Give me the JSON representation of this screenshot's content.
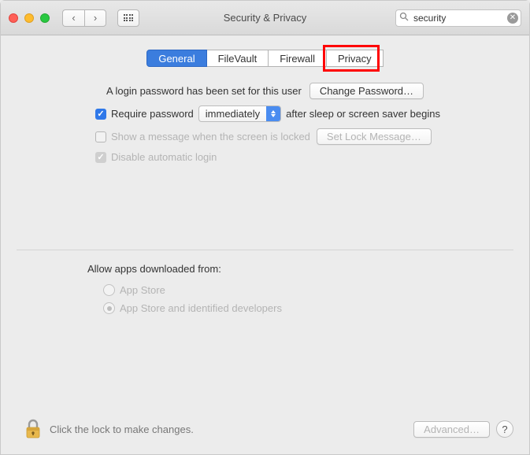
{
  "window": {
    "title": "Security & Privacy"
  },
  "search": {
    "value": "security"
  },
  "tabs": [
    {
      "label": "General",
      "active": true
    },
    {
      "label": "FileVault",
      "active": false
    },
    {
      "label": "Firewall",
      "active": false
    },
    {
      "label": "Privacy",
      "active": false
    }
  ],
  "main": {
    "login_password_text": "A login password has been set for this user",
    "change_password_btn": "Change Password…",
    "require_password_label": "Require password",
    "require_password_select": "immediately",
    "require_password_suffix": "after sleep or screen saver begins",
    "show_message_label": "Show a message when the screen is locked",
    "set_lock_message_btn": "Set Lock Message…",
    "disable_auto_login_label": "Disable automatic login",
    "allow_apps_title": "Allow apps downloaded from:",
    "radio_app_store": "App Store",
    "radio_identified": "App Store and identified developers"
  },
  "footer": {
    "lock_text": "Click the lock to make changes.",
    "advanced_btn": "Advanced…"
  }
}
